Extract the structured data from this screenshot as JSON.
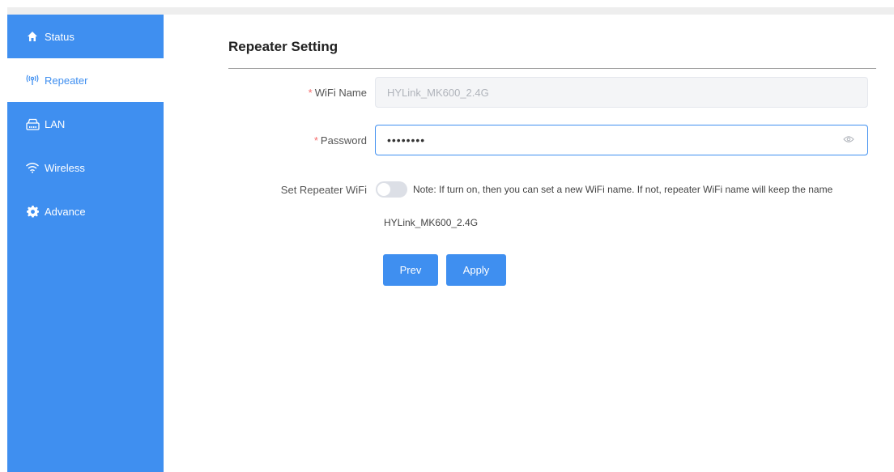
{
  "sidebar": {
    "items": [
      {
        "label": "Status",
        "icon": "home-icon"
      },
      {
        "label": "Repeater",
        "icon": "antenna-icon"
      },
      {
        "label": "LAN",
        "icon": "router-icon"
      },
      {
        "label": "Wireless",
        "icon": "wifi-icon"
      },
      {
        "label": "Advance",
        "icon": "gear-icon"
      }
    ],
    "active_index": 1
  },
  "page": {
    "title": "Repeater Setting"
  },
  "form": {
    "wifi_name": {
      "required_mark": "*",
      "label": "WiFi Name",
      "value": "HYLink_MK600_2.4G"
    },
    "password": {
      "required_mark": "*",
      "label": "Password",
      "value": "••••••••"
    },
    "set_repeater_wifi": {
      "label": "Set Repeater WiFi",
      "enabled": false,
      "note": "Note: If turn on, then you can set a new WiFi name. If not, repeater WiFi name will keep the name",
      "note_continued": "HYLink_MK600_2.4G"
    }
  },
  "buttons": {
    "prev": "Prev",
    "apply": "Apply"
  },
  "colors": {
    "accent": "#3f8ff0",
    "required": "#f56c6c"
  }
}
